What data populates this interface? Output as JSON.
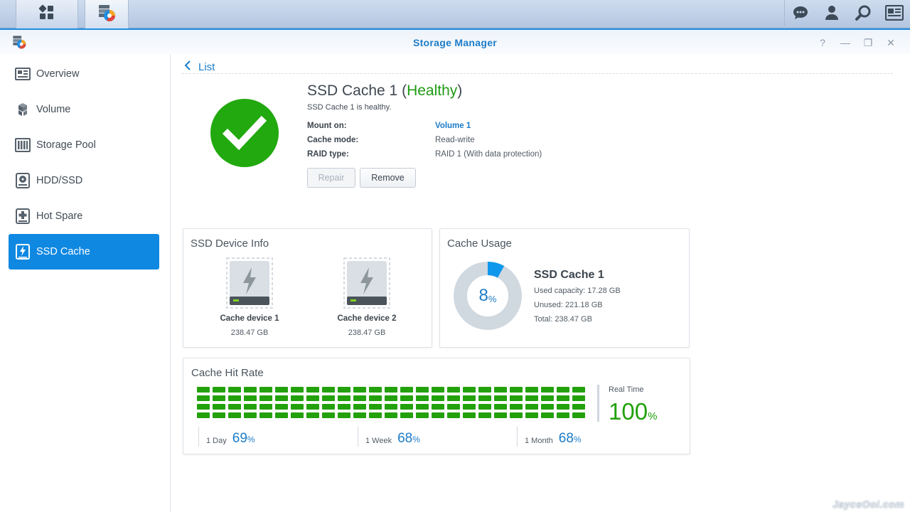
{
  "taskbar": {
    "main_menu_icon": "grid-menu-icon",
    "app_icon": "storage-manager-icon",
    "right_icons": [
      "chat-icon",
      "user-icon",
      "search-icon",
      "widgets-icon"
    ]
  },
  "window": {
    "title": "Storage Manager",
    "controls": {
      "help": "?",
      "minimize": "—",
      "restore": "❐",
      "close": "✕"
    }
  },
  "sidebar": {
    "items": [
      {
        "label": "Overview",
        "icon": "overview-icon",
        "active": false
      },
      {
        "label": "Volume",
        "icon": "volume-icon",
        "active": false
      },
      {
        "label": "Storage Pool",
        "icon": "storage-pool-icon",
        "active": false
      },
      {
        "label": "HDD/SSD",
        "icon": "hdd-icon",
        "active": false
      },
      {
        "label": "Hot Spare",
        "icon": "hot-spare-icon",
        "active": false
      },
      {
        "label": "SSD Cache",
        "icon": "ssd-cache-icon",
        "active": true
      }
    ]
  },
  "main": {
    "back_label": "List",
    "cache": {
      "name": "SSD Cache 1",
      "status": "Healthy",
      "subtitle": "SSD Cache 1 is healthy.",
      "info": [
        {
          "label": "Mount on:",
          "value": "Volume 1"
        },
        {
          "label": "Cache mode:",
          "value": "Read-write"
        },
        {
          "label": "RAID type:",
          "value": "RAID 1 (With data protection)"
        }
      ]
    },
    "buttons": {
      "repair": "Repair",
      "remove": "Remove"
    },
    "device_info": {
      "title": "SSD Device Info",
      "devices": [
        {
          "name": "Cache device 1",
          "size": "238.47 GB"
        },
        {
          "name": "Cache device 2",
          "size": "238.47 GB"
        }
      ]
    },
    "cache_usage": {
      "title": "Cache Usage",
      "percent": "8",
      "percent_unit": "%",
      "used_fraction": 0.08,
      "name": "SSD Cache 1",
      "used": "Used capacity: 17.28 GB",
      "unused": "Unused: 221.18 GB",
      "total": "Total: 238.47 GB"
    },
    "hit_rate": {
      "title": "Cache Hit Rate",
      "bar_color": "#23a10c",
      "columns": 25,
      "rows": 4,
      "realtime_label": "Real Time",
      "realtime_value": "100",
      "unit": "%",
      "periods": [
        {
          "label": "1 Day",
          "value": "69"
        },
        {
          "label": "1 Week",
          "value": "68"
        },
        {
          "label": "1 Month",
          "value": "68"
        }
      ]
    }
  },
  "colors": {
    "accent": "#0f88e2",
    "healthy": "#1e9b12",
    "link": "#1c7cc8",
    "donut_track": "#d0d8e0"
  },
  "watermark": "JayceOoi.com"
}
